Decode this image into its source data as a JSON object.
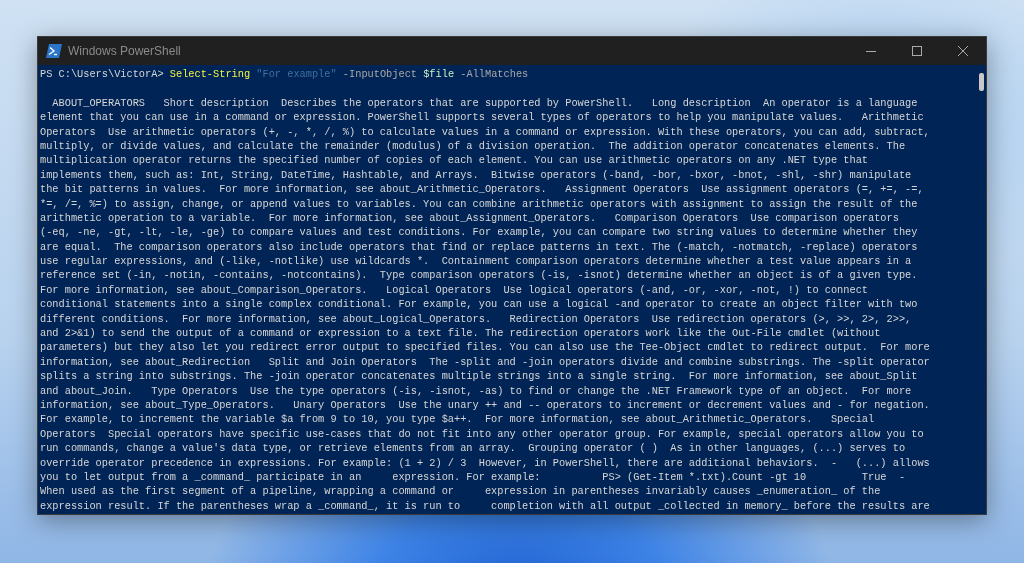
{
  "window": {
    "title": "Windows PowerShell"
  },
  "console": {
    "command": [
      {
        "text": "PS C:\\Users\\VictorA>",
        "kind": "prompt"
      },
      {
        "text": "Select-String",
        "kind": "command"
      },
      {
        "text": "\"For example\"",
        "kind": "string"
      },
      {
        "text": "-InputObject",
        "kind": "parameter"
      },
      {
        "text": "$file",
        "kind": "variable"
      },
      {
        "text": "-AllMatches",
        "kind": "parameter"
      }
    ],
    "output_lines": [
      "  ABOUT_OPERATORS   Short description  Describes the operators that are supported by PowerShell.   Long description  An operator is a language",
      "element that you can use in a command or expression. PowerShell supports several types of operators to help you manipulate values.   Arithmetic",
      "Operators  Use arithmetic operators (+, -, *, /, %) to calculate values in a command or expression. With these operators, you can add, subtract,",
      "multiply, or divide values, and calculate the remainder (modulus) of a division operation.  The addition operator concatenates elements. The",
      "multiplication operator returns the specified number of copies of each element. You can use arithmetic operators on any .NET type that",
      "implements them, such as: Int, String, DateTime, Hashtable, and Arrays.  Bitwise operators (-band, -bor, -bxor, -bnot, -shl, -shr) manipulate",
      "the bit patterns in values.  For more information, see about_Arithmetic_Operators.   Assignment Operators  Use assignment operators (=, +=, -=,",
      "*=, /=, %=) to assign, change, or append values to variables. You can combine arithmetic operators with assignment to assign the result of the",
      "arithmetic operation to a variable.  For more information, see about_Assignment_Operators.   Comparison Operators  Use comparison operators",
      "(-eq, -ne, -gt, -lt, -le, -ge) to compare values and test conditions. For example, you can compare two string values to determine whether they",
      "are equal.  The comparison operators also include operators that find or replace patterns in text. The (-match, -notmatch, -replace) operators",
      "use regular expressions, and (-like, -notlike) use wildcards *.  Containment comparison operators determine whether a test value appears in a",
      "reference set (-in, -notin, -contains, -notcontains).  Type comparison operators (-is, -isnot) determine whether an object is of a given type.",
      "For more information, see about_Comparison_Operators.   Logical Operators  Use logical operators (-and, -or, -xor, -not, !) to connect",
      "conditional statements into a single complex conditional. For example, you can use a logical -and operator to create an object filter with two",
      "different conditions.  For more information, see about_Logical_Operators.   Redirection Operators  Use redirection operators (>, >>, 2>, 2>>,",
      "and 2>&1) to send the output of a command or expression to a text file. The redirection operators work like the Out-File cmdlet (without",
      "parameters) but they also let you redirect error output to specified files. You can also use the Tee-Object cmdlet to redirect output.  For more",
      "information, see about_Redirection   Split and Join Operators  The -split and -join operators divide and combine substrings. The -split operator",
      "splits a string into substrings. The -join operator concatenates multiple strings into a single string.  For more information, see about_Split",
      "and about_Join.   Type Operators  Use the type operators (-is, -isnot, -as) to find or change the .NET Framework type of an object.  For more",
      "information, see about_Type_Operators.   Unary Operators  Use the unary ++ and -- operators to increment or decrement values and - for negation.",
      "For example, to increment the variable $a from 9 to 10, you type $a++.  For more information, see about_Arithmetic_Operators.   Special",
      "Operators  Special operators have specific use-cases that do not fit into any other operator group. For example, special operators allow you to",
      "run commands, change a value's data type, or retrieve elements from an array.  Grouping operator ( )  As in other languages, (...) serves to",
      "override operator precedence in expressions. For example: (1 + 2) / 3  However, in PowerShell, there are additional behaviors.  -   (...) allows",
      "you to let output from a _command_ participate in an     expression. For example:          PS> (Get-Item *.txt).Count -gt 10         True  -",
      "When used as the first segment of a pipeline, wrapping a command or     expression in parentheses invariably causes _enumeration_ of the",
      "expression result. If the parentheses wrap a _command_, it is run to     completion with all output _collected in memory_ before the results are"
    ]
  }
}
